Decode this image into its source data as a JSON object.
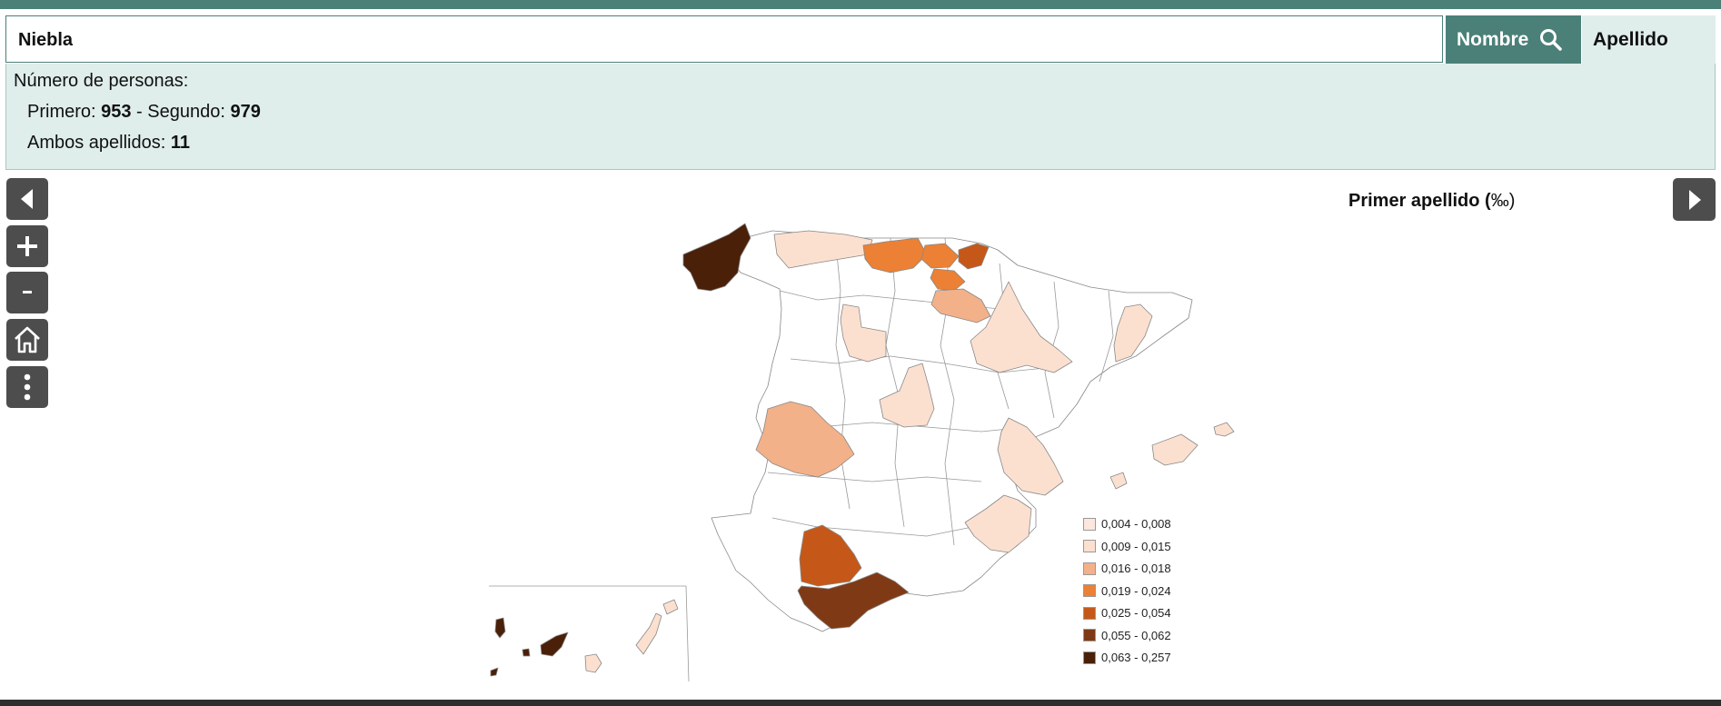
{
  "search": {
    "value": "Niebla"
  },
  "buttons": {
    "nombre": "Nombre",
    "apellido": "Apellido"
  },
  "info": {
    "heading": "Número de personas:",
    "primero_label": "Primero: ",
    "primero_value": "953",
    "sep": " - ",
    "segundo_label": "Segundo: ",
    "segundo_value": "979",
    "ambos_label": "Ambos apellidos: ",
    "ambos_value": "11"
  },
  "map": {
    "title": "Primer apellido (",
    "title_unit": "‰)",
    "legend": [
      {
        "label": "0,004 - 0,008",
        "color": "#fbe7dd"
      },
      {
        "label": "0,009 - 0,015",
        "color": "#fbe0d0"
      },
      {
        "label": "0,016 - 0,018",
        "color": "#f3b189"
      },
      {
        "label": "0,019 - 0,024",
        "color": "#ec8034"
      },
      {
        "label": "0,025 - 0,054",
        "color": "#c55818"
      },
      {
        "label": "0,055 - 0,062",
        "color": "#7f3a15"
      },
      {
        "label": "0,063 - 0,257",
        "color": "#4a2008"
      }
    ]
  },
  "colors": {
    "accent": "#4a8078",
    "info_bg": "#dfedeb",
    "control_bg": "#4d4d4d"
  },
  "icons": {
    "nav_left": "triangle-left-icon",
    "zoom_in": "plus-icon",
    "zoom_out": "minus-icon",
    "home": "home-icon",
    "more": "vertical-dots-icon",
    "nav_right": "triangle-right-icon",
    "search": "magnifier-icon"
  }
}
